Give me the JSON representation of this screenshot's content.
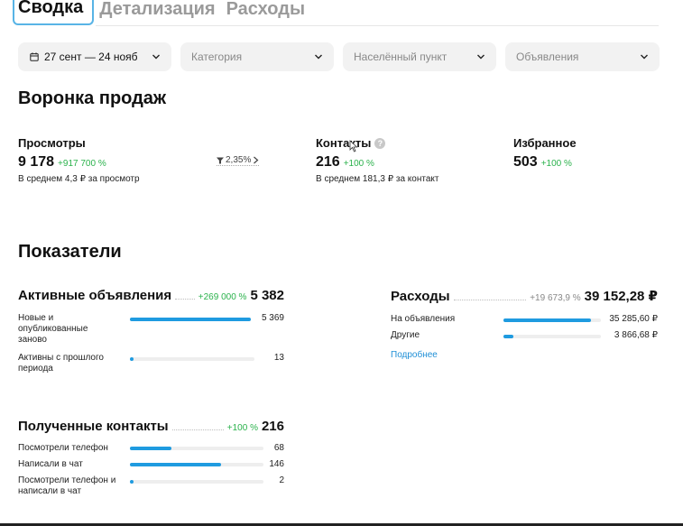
{
  "tabs": [
    {
      "label": "Сводка",
      "active": true
    },
    {
      "label": "Детализация",
      "active": false
    },
    {
      "label": "Расходы",
      "active": false
    }
  ],
  "filters": {
    "date": "27 сент — 24 нояб",
    "category_placeholder": "Категория",
    "location_placeholder": "Населённый пункт",
    "ads_placeholder": "Объявления"
  },
  "funnel": {
    "title": "Воронка продаж",
    "views": {
      "label": "Просмотры",
      "value": "9 178",
      "delta": "+917 700 %",
      "sub": "В среднем 4,3 ₽ за просмотр"
    },
    "conversion": "2,35%",
    "contacts": {
      "label": "Контакты",
      "help": "?",
      "value": "216",
      "delta": "+100 %",
      "sub": "В среднем 181,3 ₽ за контакт"
    },
    "favorites": {
      "label": "Избранное",
      "value": "503",
      "delta": "+100 %"
    }
  },
  "indicators": {
    "title": "Показатели",
    "active_ads": {
      "title": "Активные объявления",
      "delta": "+269 000 %",
      "total": "5 382",
      "rows": [
        {
          "label": "Новые и опубликованные заново",
          "value": "5 369",
          "fill": 1.0
        },
        {
          "label": "Активны с прошлого периода",
          "value": "13",
          "fill": 0.02
        }
      ]
    },
    "expenses": {
      "title": "Расходы",
      "delta": "+19 673,9 %",
      "total": "39 152,28 ₽",
      "rows": [
        {
          "label": "На объявления",
          "value": "35 285,60 ₽",
          "fill": 0.9
        },
        {
          "label": "Другие",
          "value": "3 866,68 ₽",
          "fill": 0.1
        }
      ],
      "more_link": "Подробнее"
    },
    "contacts": {
      "title": "Полученные контакты",
      "delta": "+100 %",
      "total": "216",
      "rows": [
        {
          "label": "Посмотрели телефон",
          "value": "68",
          "fill": 0.31
        },
        {
          "label": "Написали в чат",
          "value": "146",
          "fill": 0.68
        },
        {
          "label": "Посмотрели телефон и написали в чат",
          "value": "2",
          "fill": 0.02
        }
      ]
    }
  },
  "colors": {
    "accent": "#1f9be0",
    "positive": "#2bb24c",
    "tab_outline": "#58b4e6"
  },
  "icons": {
    "date": "calendar-icon",
    "dropdown": "chevron-down-icon",
    "help": "help-circle-icon",
    "conversion": "filter-funnel-icon"
  }
}
